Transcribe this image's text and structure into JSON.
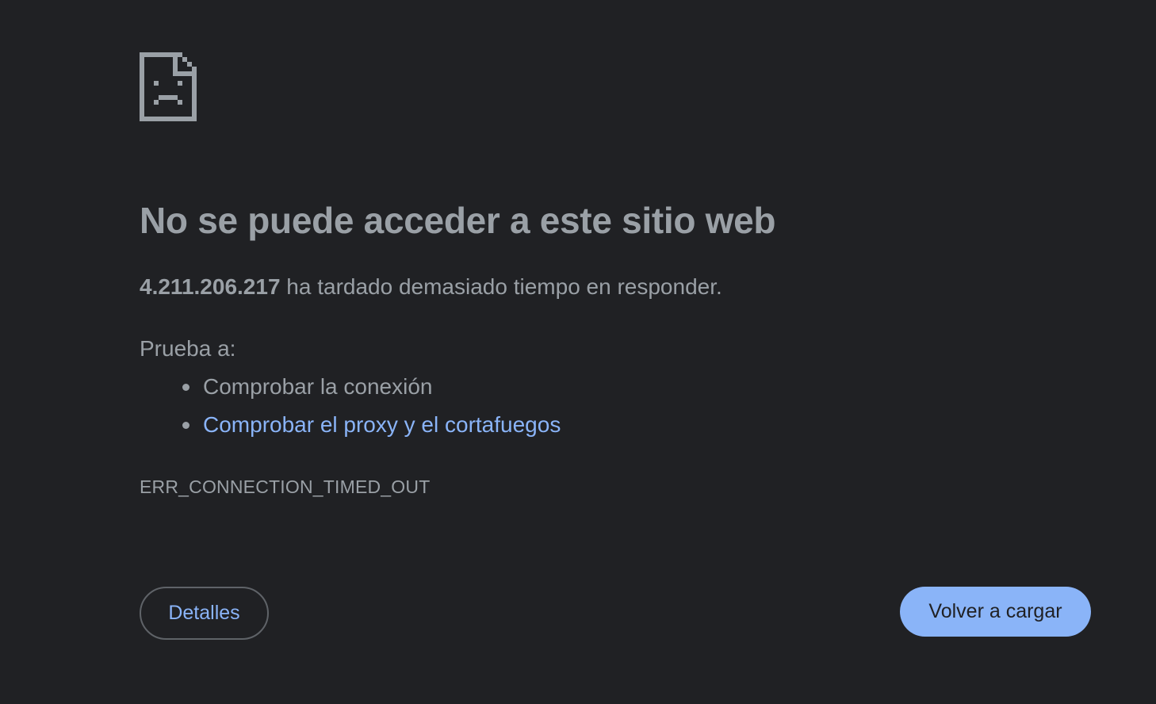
{
  "error": {
    "icon": "sad-page-icon",
    "title": "No se puede acceder a este sitio web",
    "host": "4.211.206.217",
    "summary_suffix": " ha tardado demasiado tiempo en responder.",
    "suggestions_heading": "Prueba a:",
    "suggestions": [
      {
        "label": "Comprobar la conexión",
        "is_link": false
      },
      {
        "label": "Comprobar el proxy y el cortafuegos",
        "is_link": true
      }
    ],
    "code": "ERR_CONNECTION_TIMED_OUT"
  },
  "buttons": {
    "details_label": "Detalles",
    "reload_label": "Volver a cargar"
  },
  "colors": {
    "background": "#202124",
    "text": "#9aa0a6",
    "link": "#8ab4f8",
    "primary_button": "#8ab4f8",
    "outline": "#5f6368"
  }
}
